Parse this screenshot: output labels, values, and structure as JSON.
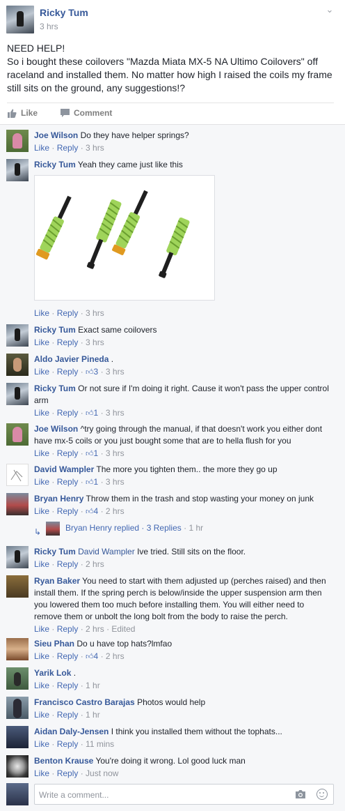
{
  "post": {
    "author": "Ricky Tum",
    "time": "3 hrs",
    "text_lines": [
      "NEED HELP!",
      "So i bought these coilovers \"Mazda Miata MX-5 NA Ultimo Coilovers\" off raceland and installed them. No matter how high I raised the coils my frame still sits on the ground, any suggestions!?"
    ],
    "actions": {
      "like": "Like",
      "comment": "Comment"
    }
  },
  "comments": [
    {
      "name": "Joe Wilson",
      "text": "Do they have helper springs?",
      "like": "Like",
      "reply": "Reply",
      "likes": "",
      "time": "3 hrs",
      "avatar": "avatar-joe-wilson"
    },
    {
      "name": "Ricky Tum",
      "text": "Yeah they came just like this",
      "like": "Like",
      "reply": "Reply",
      "likes": "",
      "time": "3 hrs",
      "avatar": "avatar-ricky-tum",
      "photo": "coilover-photo"
    },
    {
      "name": "Ricky Tum",
      "text": "Exact same coilovers",
      "like": "Like",
      "reply": "Reply",
      "likes": "",
      "time": "3 hrs",
      "avatar": "avatar-ricky-tum"
    },
    {
      "name": "Aldo Javier Pineda",
      "text": ".",
      "like": "Like",
      "reply": "Reply",
      "likes": "3",
      "time": "3 hrs",
      "avatar": "avatar-aldo"
    },
    {
      "name": "Ricky Tum",
      "text": "Or not sure if I'm doing it right. Cause it won't pass the upper control arm",
      "like": "Like",
      "reply": "Reply",
      "likes": "1",
      "time": "3 hrs",
      "avatar": "avatar-ricky-tum"
    },
    {
      "name": "Joe Wilson",
      "text": "^try going through the manual, if that doesn't work you either dont have mx-5 coils or you just bought some that are to hella flush for you",
      "like": "Like",
      "reply": "Reply",
      "likes": "1",
      "time": "3 hrs",
      "avatar": "avatar-joe-wilson"
    },
    {
      "name": "David Wampler",
      "text": "The more you tighten them.. the more they go up",
      "like": "Like",
      "reply": "Reply",
      "likes": "1",
      "time": "3 hrs",
      "avatar": "avatar-david"
    },
    {
      "name": "Bryan Henry",
      "text": "Throw them in the trash and stop wasting your money on junk",
      "like": "Like",
      "reply": "Reply",
      "likes": "4",
      "time": "2 hrs",
      "avatar": "avatar-bryan"
    },
    {
      "name": "Ricky Tum",
      "mention": "David Wampler",
      "text": "Ive tried. Still sits on the floor.",
      "like": "Like",
      "reply": "Reply",
      "likes": "",
      "time": "2 hrs",
      "avatar": "avatar-ricky-tum"
    },
    {
      "name": "Ryan Baker",
      "text": "You need to start with them adjusted up (perches raised) and then install them. If the spring perch is below/inside the upper suspension arm then you lowered them too much before installing them. You will either need to remove them or unbolt the long bolt from the body to raise the perch.",
      "like": "Like",
      "reply": "Reply",
      "likes": "",
      "time": "2 hrs",
      "edited": "Edited",
      "avatar": "avatar-ryan"
    },
    {
      "name": "Sieu Phan",
      "text": "Do u have top hats?lmfao",
      "like": "Like",
      "reply": "Reply",
      "likes": "4",
      "time": "2 hrs",
      "avatar": "avatar-sieu"
    },
    {
      "name": "Yarik Lok",
      "text": ".",
      "like": "Like",
      "reply": "Reply",
      "likes": "",
      "time": "1 hr",
      "avatar": "avatar-yarik"
    },
    {
      "name": "Francisco Castro Barajas",
      "text": "Photos would help",
      "like": "Like",
      "reply": "Reply",
      "likes": "",
      "time": "1 hr",
      "avatar": "avatar-francisco"
    },
    {
      "name": "Aidan Daly-Jensen",
      "text": "I think you installed them without the tophats...",
      "like": "Like",
      "reply": "Reply",
      "likes": "",
      "time": "11 mins",
      "avatar": "avatar-aidan"
    },
    {
      "name": "Benton Krause",
      "text": "You're doing it wrong. Lol good luck man",
      "like": "Like",
      "reply": "Reply",
      "likes": "",
      "time": "Just now",
      "avatar": "avatar-benton"
    }
  ],
  "replies_preview": {
    "text": "Bryan Henry replied",
    "count": "3 Replies",
    "time": "1 hr"
  },
  "composer": {
    "placeholder": "Write a comment..."
  },
  "icons": {
    "like": "thumbs-up-icon",
    "comment": "speech-bubble-icon",
    "camera": "camera-icon",
    "emoji": "smiley-icon",
    "menu": "chevron-down-icon",
    "reply_arrow": "reply-arrow-icon"
  },
  "colors": {
    "link": "#365899",
    "action": "#4267b2",
    "meta": "#90949c",
    "coilover_spring": "#9fd45a",
    "coilover_body": "#1f1f1f",
    "coilover_cap": "#e09a20"
  }
}
